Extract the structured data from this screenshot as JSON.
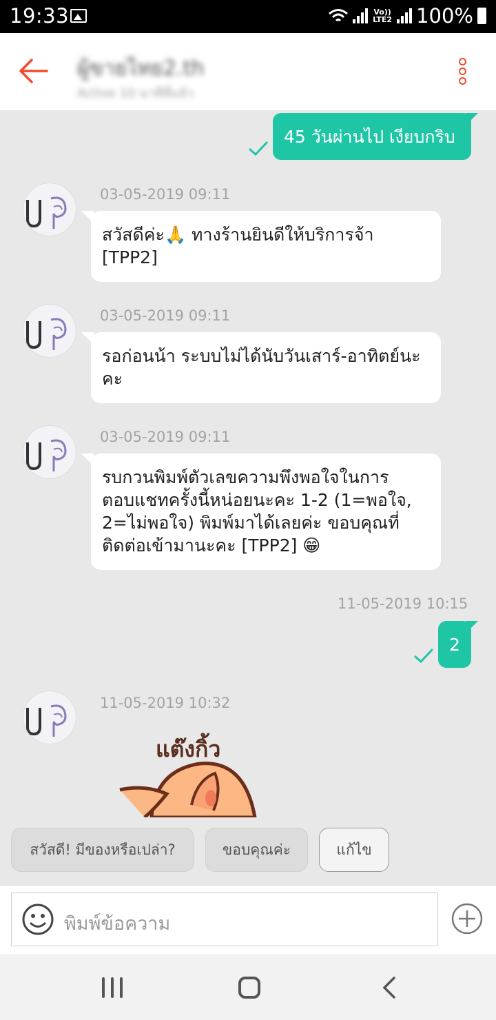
{
  "status_bar": {
    "time": "19:33",
    "network": "Vo)) LTE2",
    "battery": "100%"
  },
  "header": {
    "title": "ผู้ขายไทย2.th",
    "subtitle": "Active 10 นาทีที่แล้ว",
    "accent_color": "#ee4d2d"
  },
  "messages": [
    {
      "id": "m1",
      "direction": "out",
      "text": "45 วันผ่านไป เงียบกริบ",
      "status": "sent-check"
    },
    {
      "id": "m2",
      "direction": "in",
      "timestamp": "03-05-2019 09:11",
      "line1": "สวัสดีค่ะ🙏  ทางร้านยินดีให้บริการจ้า",
      "line2": "[TPP2]"
    },
    {
      "id": "m3",
      "direction": "in",
      "timestamp": "03-05-2019 09:11",
      "line1": "รอก่อนน้า ระบบไม่ได้นับวันเสาร์-อาทิตย์นะ",
      "line2": "คะ"
    },
    {
      "id": "m4",
      "direction": "in",
      "timestamp": "03-05-2019 09:11",
      "line1": "รบกวนพิมพ์ตัวเลขความพึงพอใจในการ",
      "line2": "ตอบแชทครั้งนี้หน่อยนะคะ 1-2 (1=พอใจ,",
      "line3": "2=ไม่พอใจ) พิมพ์มาได้เลยค่ะ ขอบคุณที่",
      "line4": "ติดต่อเข้ามานะคะ [TPP2] 😁"
    },
    {
      "id": "m5",
      "direction": "out",
      "timestamp": "11-05-2019 10:15",
      "text": "2",
      "status": "sent-check"
    },
    {
      "id": "m6",
      "direction": "in",
      "timestamp": "11-05-2019 10:32",
      "sticker_text": "แต๊งกิ้ว"
    }
  ],
  "quick_replies": [
    "สวัสดี! มีของหรือเปล่า?",
    "ขอบคุณค่ะ",
    "แก้ไข"
  ],
  "input": {
    "placeholder": "พิมพ์ข้อความ"
  },
  "colors": {
    "outgoing_bubble": "#1fc6a6",
    "incoming_bubble": "#ffffff",
    "background": "#e8e8e8"
  }
}
